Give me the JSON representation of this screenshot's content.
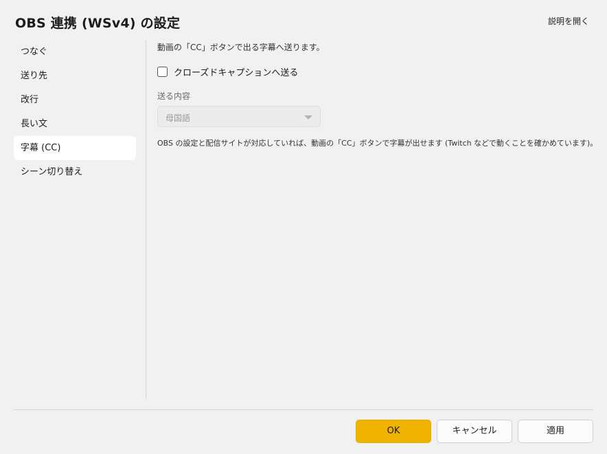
{
  "header": {
    "title": "OBS 連携 (WSv4) の設定",
    "help_link": "説明を開く"
  },
  "sidebar": {
    "items": [
      {
        "label": "つなぐ",
        "active": false
      },
      {
        "label": "送り先",
        "active": false
      },
      {
        "label": "改行",
        "active": false
      },
      {
        "label": "長い文",
        "active": false
      },
      {
        "label": "字幕 (CC)",
        "active": true
      },
      {
        "label": "シーン切り替え",
        "active": false
      }
    ]
  },
  "main": {
    "description": "動画の「CC」ボタンで出る字幕へ送ります。",
    "closed_caption_checkbox": {
      "label": "クローズドキャプションへ送る",
      "checked": false
    },
    "send_content": {
      "label": "送る内容",
      "selected": "母国語",
      "disabled": true
    },
    "note": "OBS の設定と配信サイトが対応していれば、動画の「CC」ボタンで字幕が出せます (Twitch などで動くことを確かめています)。"
  },
  "footer": {
    "ok_label": "OK",
    "cancel_label": "キャンセル",
    "apply_label": "適用"
  },
  "colors": {
    "accent": "#f0b400",
    "background": "#f1f1f1",
    "active_nav": "#ffffff"
  }
}
